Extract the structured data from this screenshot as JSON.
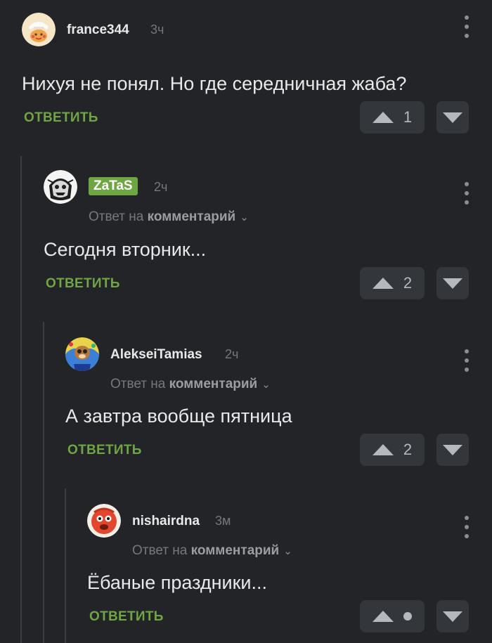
{
  "comments": [
    {
      "username": "france344",
      "time": "3ч",
      "text": "Нихуя не понял. Но где середничная жаба?",
      "reply_label": "ОТВЕТИТЬ",
      "upvotes": "1"
    },
    {
      "username": "ZaTaS",
      "time": "2ч",
      "reply_prefix": "Ответ на",
      "reply_target": "комментарий",
      "text": "Сегодня вторник...",
      "reply_label": "ОТВЕТИТЬ",
      "upvotes": "2"
    },
    {
      "username": "AlekseiTamias",
      "time": "2ч",
      "reply_prefix": "Ответ на",
      "reply_target": "комментарий",
      "text": "А завтра вообще пятница",
      "reply_label": "ОТВЕТИТЬ",
      "upvotes": "2"
    },
    {
      "username": "nishairdna",
      "time": "3м",
      "reply_prefix": "Ответ на",
      "reply_target": "комментарий",
      "text": "Ёбаные праздники...",
      "reply_label": "ОТВЕТИТЬ"
    }
  ],
  "colors": {
    "background": "#222427",
    "accent": "#6fa543",
    "muted": "#75797f",
    "button_bg": "#33363a"
  }
}
